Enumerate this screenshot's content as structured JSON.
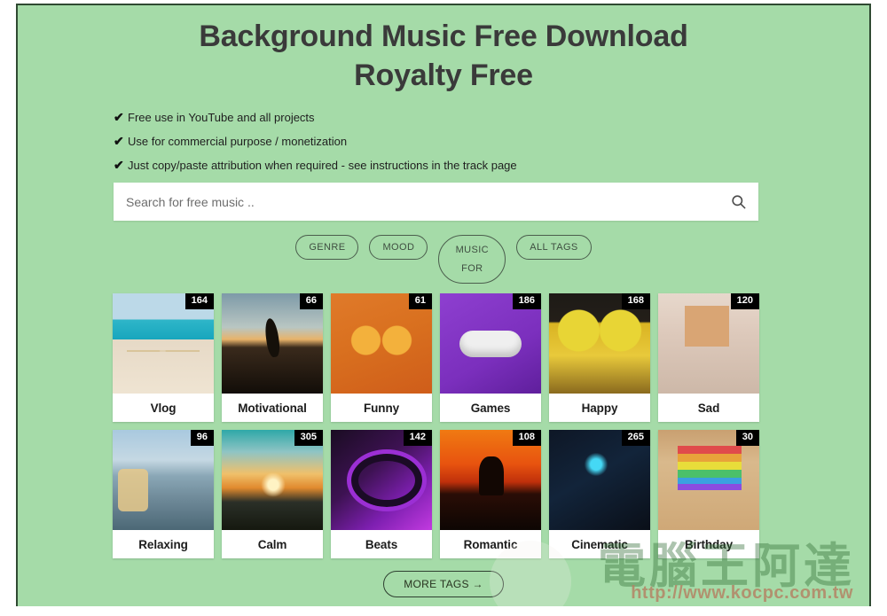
{
  "header": {
    "title_line1": "Background Music Free Download",
    "title_line2": "Royalty Free"
  },
  "benefits": [
    {
      "check": "✔",
      "text": "Free use in YouTube and all projects"
    },
    {
      "check": "✔",
      "text": "Use for commercial purpose / monetization"
    },
    {
      "check": "✔",
      "text": "Just copy/paste attribution when required - see instructions in the track page"
    }
  ],
  "search": {
    "placeholder": "Search for free music ..",
    "value": "",
    "icon": "search-icon"
  },
  "filters": [
    {
      "label": "GENRE",
      "tall": false
    },
    {
      "label": "MOOD",
      "tall": false
    },
    {
      "label": "MUSIC",
      "label2": "FOR",
      "tall": true
    },
    {
      "label": "ALL TAGS",
      "tall": false
    }
  ],
  "tags": [
    {
      "label": "Vlog",
      "count": "164",
      "art": "art-vlog"
    },
    {
      "label": "Motivational",
      "count": "66",
      "art": "art-motiv"
    },
    {
      "label": "Funny",
      "count": "61",
      "art": "art-funny"
    },
    {
      "label": "Games",
      "count": "186",
      "art": "art-games"
    },
    {
      "label": "Happy",
      "count": "168",
      "art": "art-happy"
    },
    {
      "label": "Sad",
      "count": "120",
      "art": "art-sad"
    },
    {
      "label": "Relaxing",
      "count": "96",
      "art": "art-relaxing"
    },
    {
      "label": "Calm",
      "count": "305",
      "art": "art-calm"
    },
    {
      "label": "Beats",
      "count": "142",
      "art": "art-beats"
    },
    {
      "label": "Romantic",
      "count": "108",
      "art": "art-romantic"
    },
    {
      "label": "Cinematic",
      "count": "265",
      "art": "art-cinematic"
    },
    {
      "label": "Birthday",
      "count": "30",
      "art": "art-birthday"
    }
  ],
  "more_tags": {
    "label": "MORE TAGS →"
  },
  "watermark": {
    "brand": "電腦王阿達",
    "url": "http://www.kocpc.com.tw"
  },
  "colors": {
    "page_background": "#a5dba8",
    "frame_border": "#2f4a32",
    "title_text": "#3a3a3a",
    "card_background": "#ffffff",
    "badge_background": "#000000",
    "badge_text": "#ffffff",
    "pill_border": "#4b5e4d",
    "watermark_brand": "#2e6b33",
    "watermark_url": "#c0392b"
  }
}
